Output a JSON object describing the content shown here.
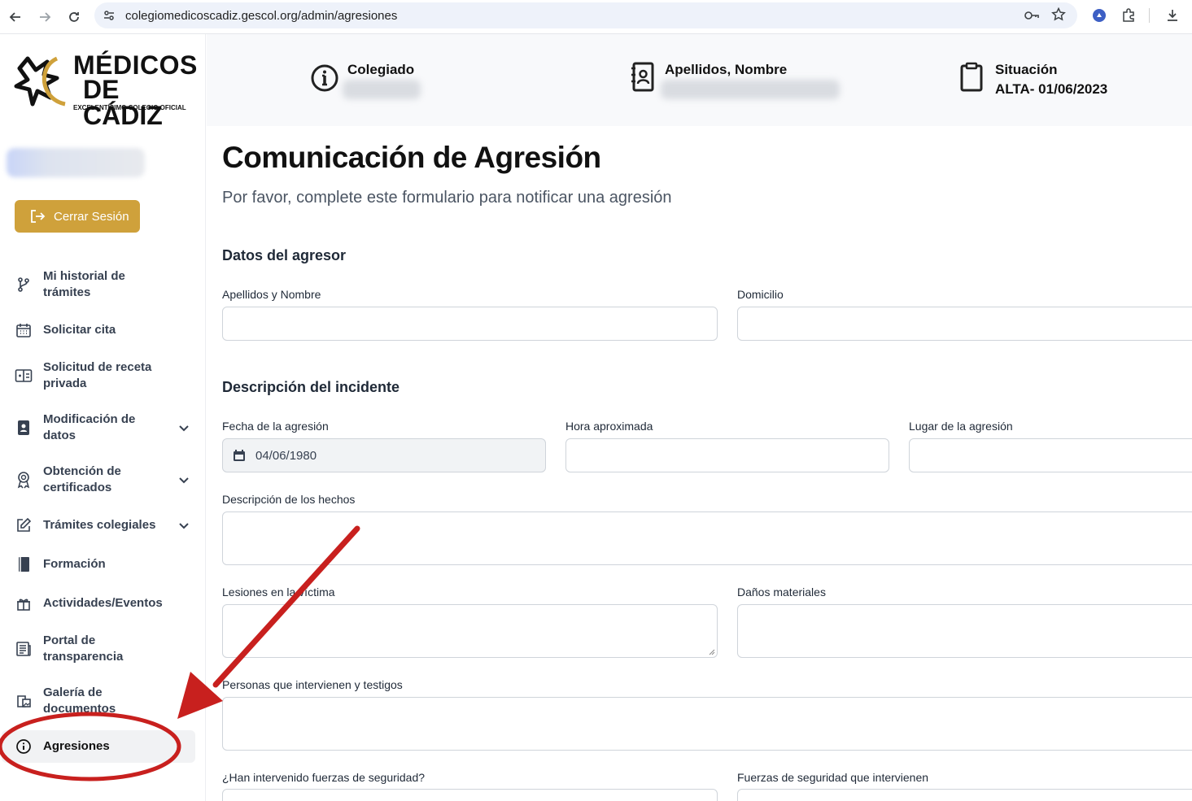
{
  "browser": {
    "url": "colegiomedicoscadiz.gescol.org/admin/agresiones"
  },
  "logo": {
    "line1": "MÉDICOS",
    "line2": "DE CÁDIZ",
    "subtitle": "EXCELENTÍSIMO COLEGIO OFICIAL"
  },
  "sidebar": {
    "logout_label": "Cerrar Sesión",
    "items": [
      {
        "label": "Mi historial de trámites",
        "icon": "branch-icon",
        "expandable": false
      },
      {
        "label": "Solicitar cita",
        "icon": "calendar-icon",
        "expandable": false
      },
      {
        "label": "Solicitud de receta privada",
        "icon": "prescription-icon",
        "expandable": false
      },
      {
        "label": "Modificación de datos",
        "icon": "id-badge-icon",
        "expandable": true
      },
      {
        "label": "Obtención de certificados",
        "icon": "award-icon",
        "expandable": true
      },
      {
        "label": "Trámites colegiales",
        "icon": "edit-icon",
        "expandable": true
      },
      {
        "label": "Formación",
        "icon": "book-icon",
        "expandable": false
      },
      {
        "label": "Actividades/Eventos",
        "icon": "gift-icon",
        "expandable": false
      },
      {
        "label": "Portal de transparencia",
        "icon": "newspaper-icon",
        "expandable": false
      },
      {
        "label": "Galería de documentos",
        "icon": "gallery-icon",
        "expandable": false
      },
      {
        "label": "Agresiones",
        "icon": "info-icon",
        "expandable": false,
        "active": true
      }
    ]
  },
  "header": {
    "colegiado_label": "Colegiado",
    "nombre_label": "Apellidos, Nombre",
    "situacion_label": "Situación",
    "situacion_value": "ALTA- 01/06/2023"
  },
  "page": {
    "title": "Comunicación de Agresión",
    "subtitle": "Por favor, complete este formulario para notificar una agresión"
  },
  "form": {
    "section_agresor": "Datos del agresor",
    "apellidos_label": "Apellidos y Nombre",
    "domicilio_label": "Domicilio",
    "section_incidente": "Descripción del incidente",
    "fecha_label": "Fecha de la agresión",
    "fecha_value": "04/06/1980",
    "hora_label": "Hora aproximada",
    "lugar_label": "Lugar de la agresión",
    "descripcion_label": "Descripción de los hechos",
    "lesiones_label": "Lesiones en la víctima",
    "danos_label": "Daños materiales",
    "personas_label": "Personas que intervienen y testigos",
    "fuerzas_label": "¿Han intervenido fuerzas de seguridad?",
    "fuerzas_cuales_label": "Fuerzas de seguridad que intervienen"
  },
  "colors": {
    "accent_gold": "#cfa13b",
    "annotation_red": "#c8201e"
  }
}
